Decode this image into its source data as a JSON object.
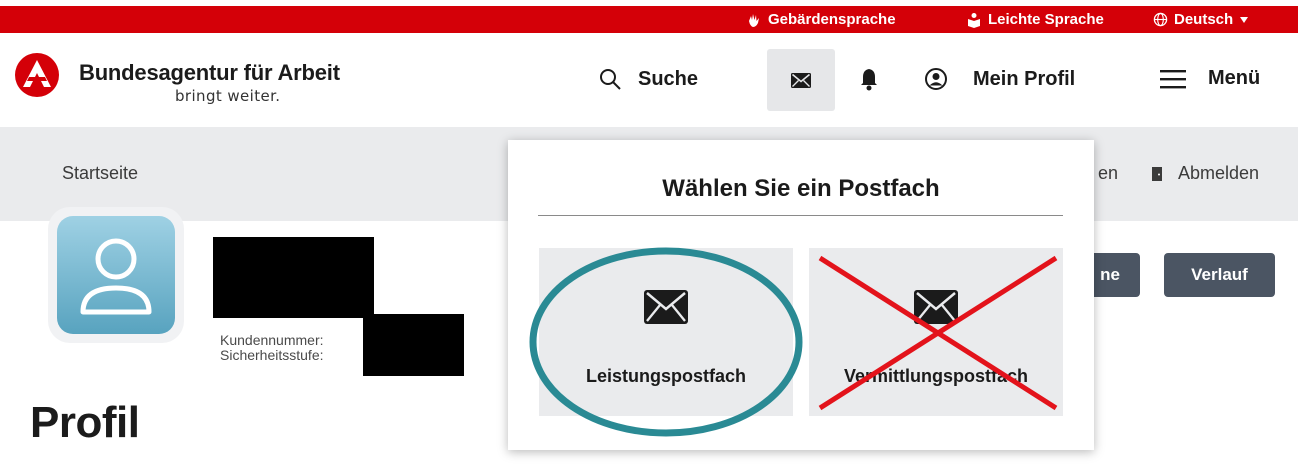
{
  "topbar": {
    "sign_language": "Gebärdensprache",
    "easy_language": "Leichte Sprache",
    "language": "Deutsch"
  },
  "header": {
    "brand_title": "Bundesagentur für Arbeit",
    "brand_subtitle": "bringt weiter.",
    "search_label": "Suche",
    "profile_label": "Mein Profil",
    "menu_label": "Menü"
  },
  "breadcrumb": {
    "home": "Startseite",
    "partial_link": "en",
    "logout": "Abmelden"
  },
  "profile": {
    "customer_number_label": "Kundennummer:",
    "security_level_label": "Sicherheitsstufe:",
    "title": "Profil",
    "partial_button": "ne",
    "history_button": "Verlauf"
  },
  "mailbox_popup": {
    "title": "Wählen Sie ein Postfach",
    "options": [
      {
        "label": "Leistungspostfach"
      },
      {
        "label": "Vermittlungspostfach"
      }
    ]
  },
  "colors": {
    "brand_red": "#d40008",
    "annotation_circle": "#2a8a94",
    "annotation_cross": "#e3131b",
    "button_dark": "#4b5563"
  }
}
